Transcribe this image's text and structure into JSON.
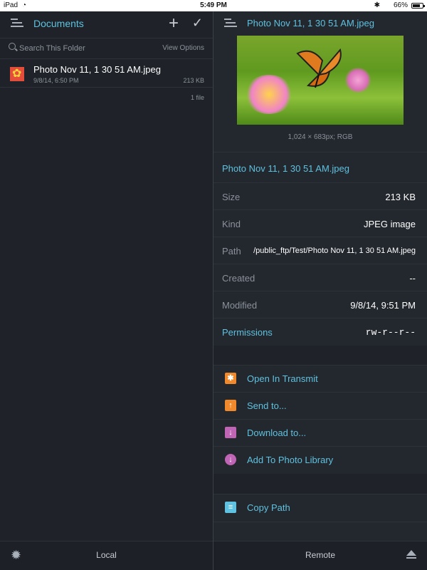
{
  "status_bar": {
    "device": "iPad",
    "time": "5:49 PM",
    "battery_pct": "66%",
    "battery_level": 0.66
  },
  "left": {
    "nav": {
      "title": "Documents",
      "add_symbol": "+",
      "done_symbol": "✓"
    },
    "search": {
      "placeholder": "Search This Folder",
      "view_options": "View Options"
    },
    "files": [
      {
        "name": "Photo Nov 11, 1 30 51 AM.jpeg",
        "date": "9/8/14, 6:50 PM",
        "size": "213 KB"
      }
    ],
    "file_count": "1 file",
    "bottom": {
      "label": "Local"
    }
  },
  "right": {
    "nav": {
      "title": "Photo Nov 11, 1 30 51 AM.jpeg"
    },
    "preview": {
      "dimensions": "1,024 × 683px; RGB"
    },
    "info": {
      "title": "Photo Nov 11, 1 30 51 AM.jpeg",
      "rows": [
        {
          "key": "Size",
          "value": "213 KB"
        },
        {
          "key": "Kind",
          "value": "JPEG image"
        },
        {
          "key": "Path",
          "value": "/public_ftp/Test/Photo Nov 11, 1 30 51 AM.jpeg"
        },
        {
          "key": "Created",
          "value": "--"
        },
        {
          "key": "Modified",
          "value": "9/8/14, 9:51 PM"
        },
        {
          "key": "Permissions",
          "value": "rw-r--r--"
        }
      ]
    },
    "actions": [
      {
        "label": "Open In Transmit",
        "icon": "transmit-icon",
        "color": "#f0892b"
      },
      {
        "label": "Send to...",
        "icon": "share-icon",
        "color": "#f0892b"
      },
      {
        "label": "Download to...",
        "icon": "download-icon",
        "color": "#c065b5"
      },
      {
        "label": "Add To Photo Library",
        "icon": "photo-library-icon",
        "color": "#c065b5"
      }
    ],
    "secondary_actions": [
      {
        "label": "Copy Path",
        "icon": "clipboard-icon",
        "color": "#5fc2e0"
      }
    ],
    "bottom": {
      "label": "Remote"
    }
  },
  "colors": {
    "accent": "#5fc2e0",
    "background": "#1f2329",
    "panel": "#23272e"
  }
}
